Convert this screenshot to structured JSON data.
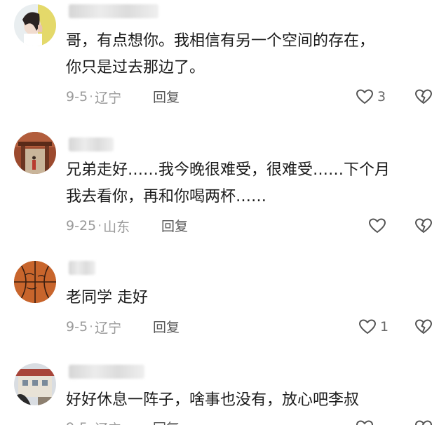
{
  "comments": [
    {
      "text": "哥，有点想你。我相信有另一个空间的存在，\n你只是过去那边了。",
      "date": "9-5",
      "location": "辽宁",
      "reply_label": "回复",
      "likes": "3",
      "avatar": "girl-avatar"
    },
    {
      "text": "兄弟走好……我今晚很难受，很难受……下个月\n我去看你，再和你喝两杯……",
      "date": "9-25",
      "location": "山东",
      "reply_label": "回复",
      "likes": "",
      "avatar": "gate-avatar"
    },
    {
      "text": "老同学 走好",
      "date": "9-5",
      "location": "辽宁",
      "reply_label": "回复",
      "likes": "1",
      "avatar": "basketball-avatar"
    },
    {
      "text": "好好休息一阵子，啥事也没有，放心吧李叔",
      "date": "9-5",
      "location": "辽宁",
      "reply_label": "回复",
      "likes": "",
      "avatar": "building-avatar"
    }
  ],
  "meta_separator": "·",
  "colors": {
    "text": "#1a1a1a",
    "meta": "#9a9a9a",
    "icon": "#555555"
  },
  "icons": {
    "like": "heart-outline-icon",
    "dislike": "broken-heart-icon"
  }
}
